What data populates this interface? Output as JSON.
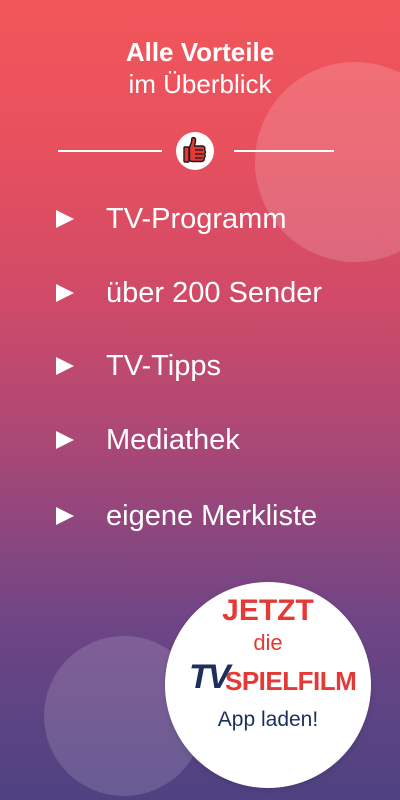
{
  "header": {
    "title_line1": "Alle Vorteile",
    "title_line2": "im Überblick",
    "badge_icon": "thumbs-up-icon"
  },
  "benefits": [
    {
      "label": "TV-Programm"
    },
    {
      "label": "über 200 Sender"
    },
    {
      "label": "TV-Tipps"
    },
    {
      "label": "Mediathek"
    },
    {
      "label": "eigene Merkliste"
    }
  ],
  "cta": {
    "line1": "JETZT",
    "line2": "die",
    "logo_tv": "TV",
    "logo_name": "SPIELFILM",
    "line3": "App laden!"
  },
  "colors": {
    "gradient_top": "#f2565a",
    "gradient_bottom": "#4e4282",
    "brand_red": "#e53935",
    "brand_navy": "#1c2f5c"
  }
}
